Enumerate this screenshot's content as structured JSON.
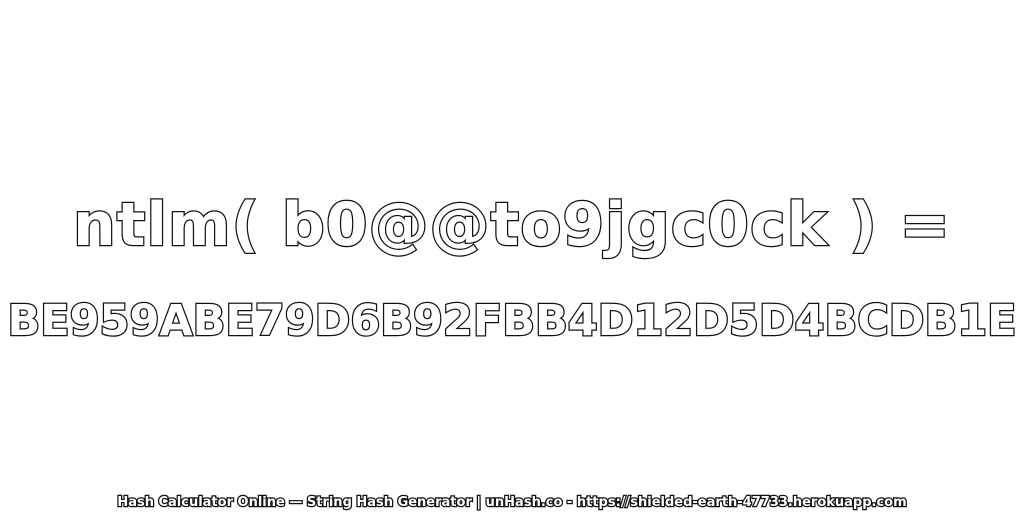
{
  "expression": "ntlm( b0@@to9jgc0ck ) =",
  "hash_value": "BE959ABE79D6B92FBB4D12D5D4BCDB1E",
  "footer": "Hash Calculator Online — String Hash Generator | unHash.co - https://shielded-earth-47733.herokuapp.com",
  "colors": {
    "background": "#ffffff",
    "text_fill": "#ffffff",
    "text_outline": "#111111"
  }
}
